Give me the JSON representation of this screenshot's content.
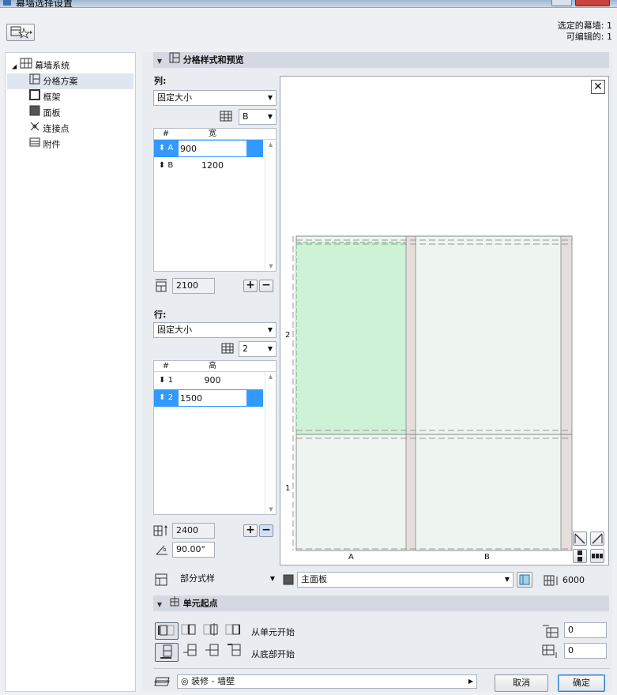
{
  "window": {
    "title": "幕墙选择设置"
  },
  "top_status": {
    "selected_label": "选定的幕墙: 1",
    "editable_label": "可编辑的: 1"
  },
  "tree": {
    "root_label": "幕墙系统",
    "items": [
      {
        "label": "分格方案",
        "icon": "grid-scheme-icon",
        "selected": true
      },
      {
        "label": "框架",
        "icon": "frame-icon"
      },
      {
        "label": "面板",
        "icon": "panel-icon"
      },
      {
        "label": "连接点",
        "icon": "junction-icon"
      },
      {
        "label": "附件",
        "icon": "accessory-icon"
      }
    ]
  },
  "section_pattern": {
    "title": "分格样式和预览"
  },
  "columns": {
    "label": "列:",
    "mode": "固定大小",
    "pattern_value": "B",
    "table_headers": [
      "#",
      "宽"
    ],
    "rows": [
      {
        "id": "A",
        "value": "900",
        "selected": true
      },
      {
        "id": "B",
        "value": "1200",
        "selected": false
      }
    ],
    "total": "2100",
    "add": "+",
    "remove": "−"
  },
  "rows": {
    "label": "行:",
    "mode": "固定大小",
    "pattern_value": "2",
    "table_headers": [
      "#",
      "高"
    ],
    "rows": [
      {
        "id": "1",
        "value": "900",
        "selected": false
      },
      {
        "id": "2",
        "value": "1500",
        "selected": true
      }
    ],
    "total": "2400",
    "angle": "90.00°",
    "add": "+",
    "remove": "−"
  },
  "preview": {
    "row_labels": [
      "2",
      "1"
    ],
    "col_labels": [
      "A",
      "B"
    ],
    "close_symbol": "✕"
  },
  "bottom_scheme": {
    "style_value": "部分式样",
    "panel_value": "主面板",
    "height_value": "6000"
  },
  "section_origin": {
    "title": "单元起点",
    "from_cell": "从单元开始",
    "from_bottom": "从底部开始",
    "offset_x": "0",
    "offset_y": "0"
  },
  "footer": {
    "layer_value": "装修 - 墙壁",
    "cancel": "取消",
    "ok": "确定"
  },
  "colors": {
    "accent_selection": "#3399ff",
    "panel_highlight": "#cdf2d6",
    "panel_fill": "#eef5f0",
    "mullion": "#e6dedd"
  }
}
